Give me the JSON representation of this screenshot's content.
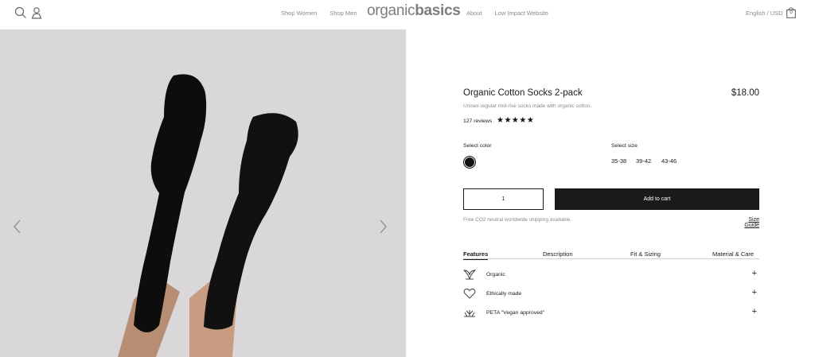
{
  "header": {
    "nav_left": [
      "Shop Women",
      "Shop Men"
    ],
    "logo_light": "organic",
    "logo_bold": "basics",
    "nav_right": [
      "About",
      "Low Impact Website"
    ],
    "locale": "English / USD",
    "cart_count": "0",
    "icons": [
      "search-icon",
      "account-icon",
      "bag-icon"
    ]
  },
  "gallery": {
    "icons": [
      "chevron-left-icon",
      "chevron-right-icon"
    ],
    "background_color": "#d9d7d9"
  },
  "product": {
    "title": "Organic Cotton Socks 2-pack",
    "price": "$18.00",
    "subtitle": "Unisex regular mid-rise socks made with organic cotton.",
    "reviews": "127 reviews",
    "rating": 5,
    "stars": "★★★★★",
    "color_label": "Select color",
    "color_swatch": "#121212",
    "size_label": "Select size",
    "sizes": [
      "35-38",
      "39-42",
      "43-46"
    ],
    "quantity": "1",
    "add_to_cart": "Add to cart",
    "shipping": "Free CO2 neutral worldwide shipping available.",
    "size_guide": "Size Guide"
  },
  "tabs": [
    "Features",
    "Description",
    "Fit & Sizing",
    "Material & Care"
  ],
  "features": [
    {
      "label": "Organic",
      "icon": "leaf-icon",
      "toggle": "+"
    },
    {
      "label": "Ethically made",
      "icon": "heart-icon",
      "toggle": "+"
    },
    {
      "label": "PETA \"Vegan approved\"",
      "icon": "plant-icon",
      "toggle": "+"
    }
  ],
  "colors": {
    "accent": "#1a1a1a",
    "muted": "#8a8a8a"
  }
}
